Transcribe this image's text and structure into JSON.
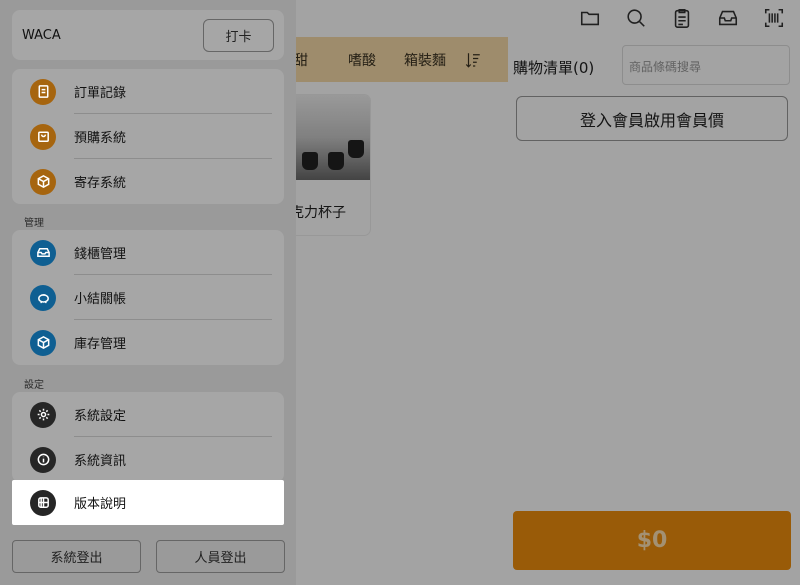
{
  "background": {
    "categories": [
      "甜",
      "嗜酸",
      "箱裝麵"
    ],
    "product_name": "克力杯子",
    "cart_title": "購物清單(0)",
    "search_placeholder": "商品條碼搜尋",
    "member_button": "登入會員啟用會員價",
    "total_button": "$0",
    "top_icons": [
      "folder-icon",
      "search-icon",
      "clipboard-icon",
      "inbox-icon",
      "barcode-scan-icon"
    ],
    "accent_color": "#f08f0e",
    "category_bar_color": "#f7dba9"
  },
  "drawer": {
    "brand": "WACA",
    "clock_in_button": "打卡",
    "group1": [
      {
        "label": "訂單記錄",
        "icon": "document-icon",
        "color": "#f08f0e"
      },
      {
        "label": "預購系統",
        "icon": "shopping-bag-icon",
        "color": "#f08f0e"
      },
      {
        "label": "寄存系統",
        "icon": "package-icon",
        "color": "#f08f0e"
      }
    ],
    "section_manage": "管理",
    "group2": [
      {
        "label": "錢櫃管理",
        "icon": "cash-drawer-icon",
        "color": "#1a8ad4"
      },
      {
        "label": "小結關帳",
        "icon": "piggy-bank-icon",
        "color": "#1a8ad4"
      },
      {
        "label": "庫存管理",
        "icon": "cube-icon",
        "color": "#1a8ad4"
      }
    ],
    "section_settings": "設定",
    "group3": [
      {
        "label": "系統設定",
        "icon": "gear-icon",
        "color": "#333333"
      },
      {
        "label": "系統資訊",
        "icon": "info-icon",
        "color": "#333333"
      },
      {
        "label": "版本說明",
        "icon": "grid-icon",
        "color": "#333333"
      }
    ],
    "logout_system": "系統登出",
    "logout_staff": "人員登出"
  }
}
